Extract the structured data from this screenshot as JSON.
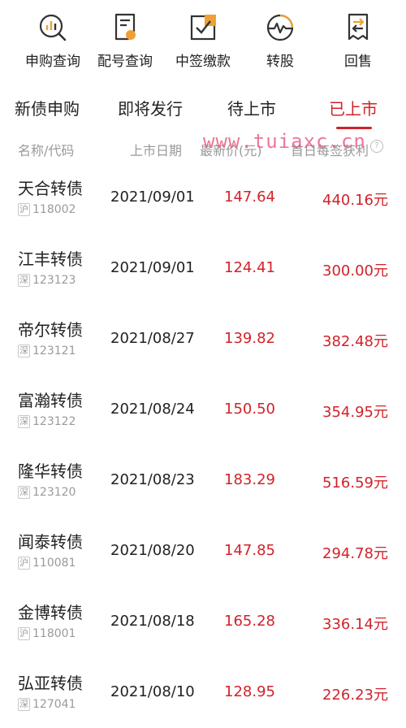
{
  "top_nav": [
    {
      "label": "申购查询",
      "icon": "search-chart-icon"
    },
    {
      "label": "配号查询",
      "icon": "document-list-icon"
    },
    {
      "label": "中签缴款",
      "icon": "checkbox-icon"
    },
    {
      "label": "转股",
      "icon": "pulse-chart-icon"
    },
    {
      "label": "回售",
      "icon": "return-document-icon"
    }
  ],
  "tabs": [
    {
      "label": "新债申购",
      "active": false
    },
    {
      "label": "即将发行",
      "active": false
    },
    {
      "label": "待上市",
      "active": false
    },
    {
      "label": "已上市",
      "active": true
    }
  ],
  "columns": {
    "name_code": "名称/代码",
    "list_date": "上市日期",
    "latest_price": "最新价(元)",
    "profit": "首日每签获利"
  },
  "watermark": "www.tuiaxc.cn",
  "bonds": [
    {
      "name": "天合转债",
      "market": "沪",
      "code": "118002",
      "list_date": "2021/09/01",
      "latest_price": "147.64",
      "profit": "440.16元"
    },
    {
      "name": "江丰转债",
      "market": "深",
      "code": "123123",
      "list_date": "2021/09/01",
      "latest_price": "124.41",
      "profit": "300.00元"
    },
    {
      "name": "帝尔转债",
      "market": "深",
      "code": "123121",
      "list_date": "2021/08/27",
      "latest_price": "139.82",
      "profit": "382.48元"
    },
    {
      "name": "富瀚转债",
      "market": "深",
      "code": "123122",
      "list_date": "2021/08/24",
      "latest_price": "150.50",
      "profit": "354.95元"
    },
    {
      "name": "隆华转债",
      "market": "深",
      "code": "123120",
      "list_date": "2021/08/23",
      "latest_price": "183.29",
      "profit": "516.59元"
    },
    {
      "name": "闻泰转债",
      "market": "沪",
      "code": "110081",
      "list_date": "2021/08/20",
      "latest_price": "147.85",
      "profit": "294.78元"
    },
    {
      "name": "金博转债",
      "market": "沪",
      "code": "118001",
      "list_date": "2021/08/18",
      "latest_price": "165.28",
      "profit": "336.14元"
    },
    {
      "name": "弘亚转债",
      "market": "深",
      "code": "127041",
      "list_date": "2021/08/10",
      "latest_price": "128.95",
      "profit": "226.23元"
    }
  ],
  "colors": {
    "accent": "#d0232a",
    "icon_highlight": "#f0a033",
    "muted": "#9a9a9a"
  }
}
